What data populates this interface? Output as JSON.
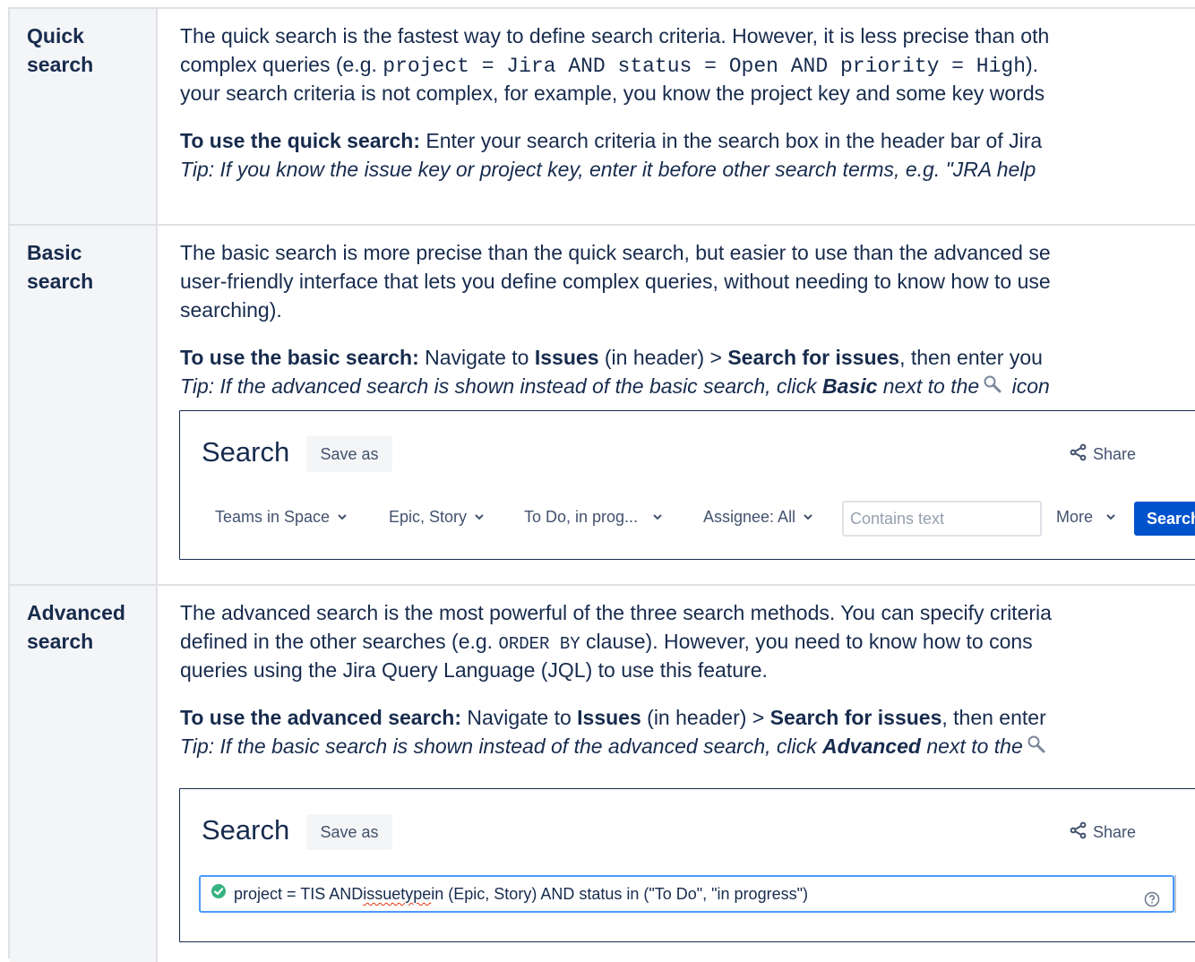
{
  "quick": {
    "heading_1": "Quick",
    "heading_2": "search",
    "p1_a": "The quick search is the fastest way to define search criteria. However, it is less precise than oth",
    "p1_b_pre": "complex queries (e.g. ",
    "p1_b_code": "project = Jira AND status = Open AND priority = High",
    "p1_b_post": ").",
    "p1_c": "your search criteria is not complex, for example, you know the project key and some key words",
    "use_bold": "To use the quick search:",
    "use_text": " Enter your search criteria in the search box in the header bar of Jira",
    "tip": "Tip: If you know the issue key or project key, enter it before other search terms, e.g. \"JRA help"
  },
  "basic": {
    "heading_1": "Basic",
    "heading_2": "search",
    "p1_a": "The basic search is more precise than the quick search, but easier to use than the advanced se",
    "p1_b": "user-friendly interface that lets you define complex queries, without needing to know how to use",
    "p1_c": "searching).",
    "use_bold": "To use the basic search:",
    "use_mid1": " Navigate to ",
    "use_issues": "Issues",
    "use_mid2": " (in header) > ",
    "use_sfi": "Search for issues",
    "use_end": ", then enter you",
    "tip_a": "Tip: If the advanced search is shown instead of the basic search, click ",
    "tip_bold": "Basic",
    "tip_b": " next to the",
    "tip_c": " icon",
    "shot": {
      "title": "Search",
      "save_as": "Save as",
      "share": "Share",
      "filters": [
        "Teams in Space",
        "Epic, Story",
        "To Do, in prog...",
        "Assignee: All"
      ],
      "text_placeholder": "Contains text",
      "more": "More",
      "search_btn": "Search"
    }
  },
  "advanced": {
    "heading_1": "Advanced",
    "heading_2": "search",
    "p1_a": "The advanced search is the most powerful of the three search methods. You can specify criteria",
    "p1_b_pre": "defined in the other searches (e.g. ",
    "p1_b_code": "ORDER BY",
    "p1_b_post": " clause). However, you need to know how to cons",
    "p1_c": "queries using the Jira Query Language (JQL) to use this feature.",
    "use_bold": "To use the advanced search:",
    "use_mid1": " Navigate to ",
    "use_issues": "Issues",
    "use_mid2": " (in header) > ",
    "use_sfi": "Search for issues",
    "use_end": ", then enter",
    "tip_a": "Tip: If the basic search is shown instead of the advanced search, click ",
    "tip_bold": "Advanced",
    "tip_b": " next to the",
    "shot": {
      "title": "Search",
      "save_as": "Save as",
      "share": "Share",
      "jql_pre": "project = TIS AND ",
      "jql_squiggle": "issuetype",
      "jql_post": " in (Epic, Story) AND status in (\"To Do\", \"in progress\")"
    }
  },
  "colors": {
    "border": "#dfe1e6",
    "header_bg": "#f4f5f7",
    "text": "#172b4d",
    "primary": "#0052cc",
    "focus": "#4c9aff",
    "success": "#36b37e"
  }
}
